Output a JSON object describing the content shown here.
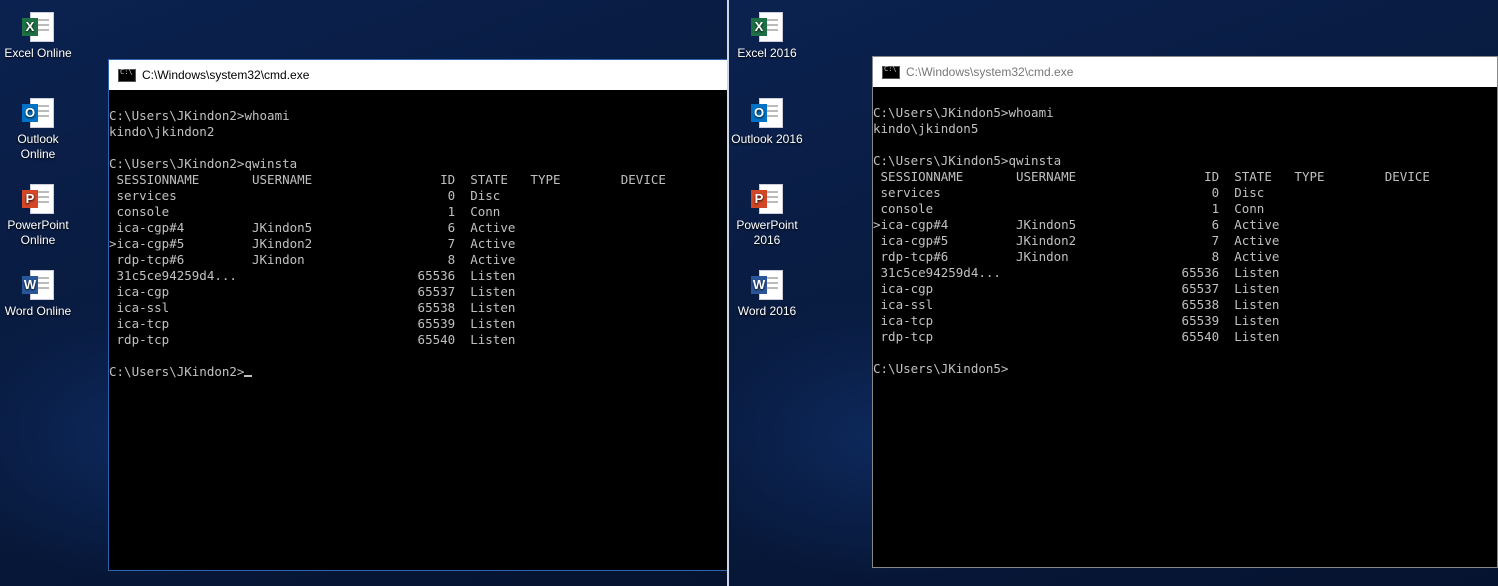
{
  "left_screen": {
    "icons": [
      {
        "name": "excel-icon",
        "badge": "X",
        "label": "Excel Online",
        "cls": "excel"
      },
      {
        "name": "outlook-icon",
        "badge": "O",
        "label": "Outlook Online",
        "cls": "outlook"
      },
      {
        "name": "powerpoint-icon",
        "badge": "P",
        "label": "PowerPoint Online",
        "cls": "ppt"
      },
      {
        "name": "word-icon",
        "badge": "W",
        "label": "Word Online",
        "cls": "word"
      }
    ],
    "window": {
      "title": "C:\\Windows\\system32\\cmd.exe",
      "lines": [
        "",
        "C:\\Users\\JKindon2>whoami",
        "kindo\\jkindon2",
        "",
        "C:\\Users\\JKindon2>qwinsta",
        " SESSIONNAME       USERNAME                 ID  STATE   TYPE        DEVICE",
        " services                                    0  Disc",
        " console                                     1  Conn",
        " ica-cgp#4         JKindon5                  6  Active",
        ">ica-cgp#5         JKindon2                  7  Active",
        " rdp-tcp#6         JKindon                   8  Active",
        " 31c5ce94259d4...                        65536  Listen",
        " ica-cgp                                 65537  Listen",
        " ica-ssl                                 65538  Listen",
        " ica-tcp                                 65539  Listen",
        " rdp-tcp                                 65540  Listen",
        "",
        "C:\\Users\\JKindon2>"
      ]
    }
  },
  "right_screen": {
    "icons": [
      {
        "name": "excel-icon",
        "badge": "X",
        "label": "Excel 2016",
        "cls": "excel"
      },
      {
        "name": "outlook-icon",
        "badge": "O",
        "label": "Outlook 2016",
        "cls": "outlook"
      },
      {
        "name": "powerpoint-icon",
        "badge": "P",
        "label": "PowerPoint 2016",
        "cls": "ppt"
      },
      {
        "name": "word-icon",
        "badge": "W",
        "label": "Word 2016",
        "cls": "word"
      }
    ],
    "window": {
      "title": "C:\\Windows\\system32\\cmd.exe",
      "lines": [
        "",
        "C:\\Users\\JKindon5>whoami",
        "kindo\\jkindon5",
        "",
        "C:\\Users\\JKindon5>qwinsta",
        " SESSIONNAME       USERNAME                 ID  STATE   TYPE        DEVICE",
        " services                                    0  Disc",
        " console                                     1  Conn",
        ">ica-cgp#4         JKindon5                  6  Active",
        " ica-cgp#5         JKindon2                  7  Active",
        " rdp-tcp#6         JKindon                   8  Active",
        " 31c5ce94259d4...                        65536  Listen",
        " ica-cgp                                 65537  Listen",
        " ica-ssl                                 65538  Listen",
        " ica-tcp                                 65539  Listen",
        " rdp-tcp                                 65540  Listen",
        "",
        "C:\\Users\\JKindon5>"
      ]
    }
  }
}
